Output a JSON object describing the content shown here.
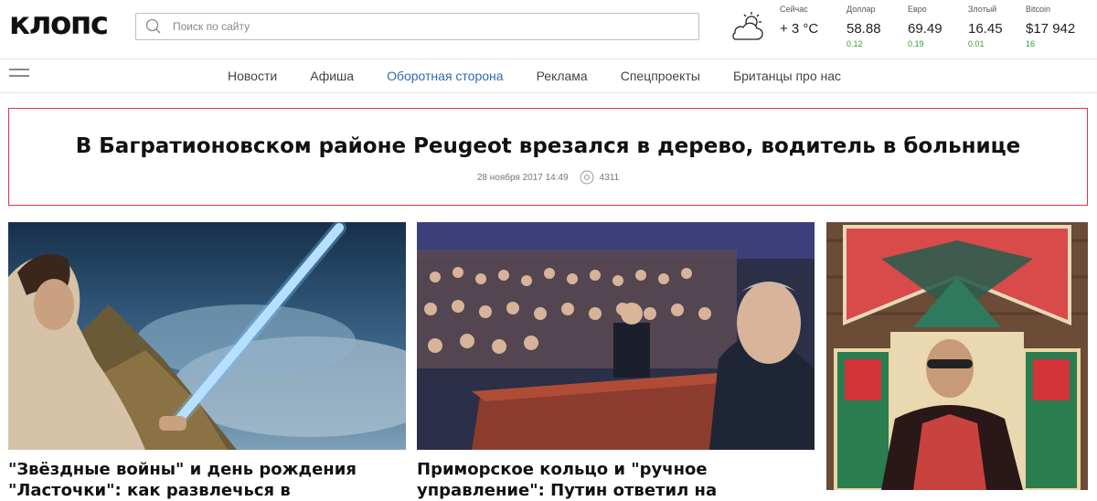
{
  "header": {
    "logo": "клопс",
    "search_placeholder": "Поиск по сайту"
  },
  "weather": {
    "label": "Сейчас",
    "value": "+ 3 °C",
    "icon": "partly-cloudy-icon"
  },
  "rates": [
    {
      "label": "Доллар",
      "value": "58.88",
      "delta": "0.12"
    },
    {
      "label": "Евро",
      "value": "69.49",
      "delta": "0.19"
    },
    {
      "label": "Злотый",
      "value": "16.45",
      "delta": "0.01"
    },
    {
      "label": "Bitcoin",
      "value": "$17 942",
      "delta": "16"
    }
  ],
  "nav": {
    "items": [
      {
        "label": "Новости"
      },
      {
        "label": "Афиша"
      },
      {
        "label": "Оборотная сторона"
      },
      {
        "label": "Реклама"
      },
      {
        "label": "Спецпроекты"
      },
      {
        "label": "Британцы про нас"
      }
    ],
    "active_index": 2,
    "active_color": "#2f6bb3"
  },
  "featured": {
    "title": "В Багратионовском районе Peugeot врезался в дерево, водитель в больнице",
    "date": "28 ноября 2017 14:49",
    "views": "4311",
    "border_color": "#e2304f"
  },
  "cards": [
    {
      "title": "\"Звёздные войны\" и день рождения \"Ласточки\": как развлечься в"
    },
    {
      "title": "Приморское кольцо и \"ручное управление\": Путин ответил на"
    },
    {
      "title": ""
    }
  ]
}
